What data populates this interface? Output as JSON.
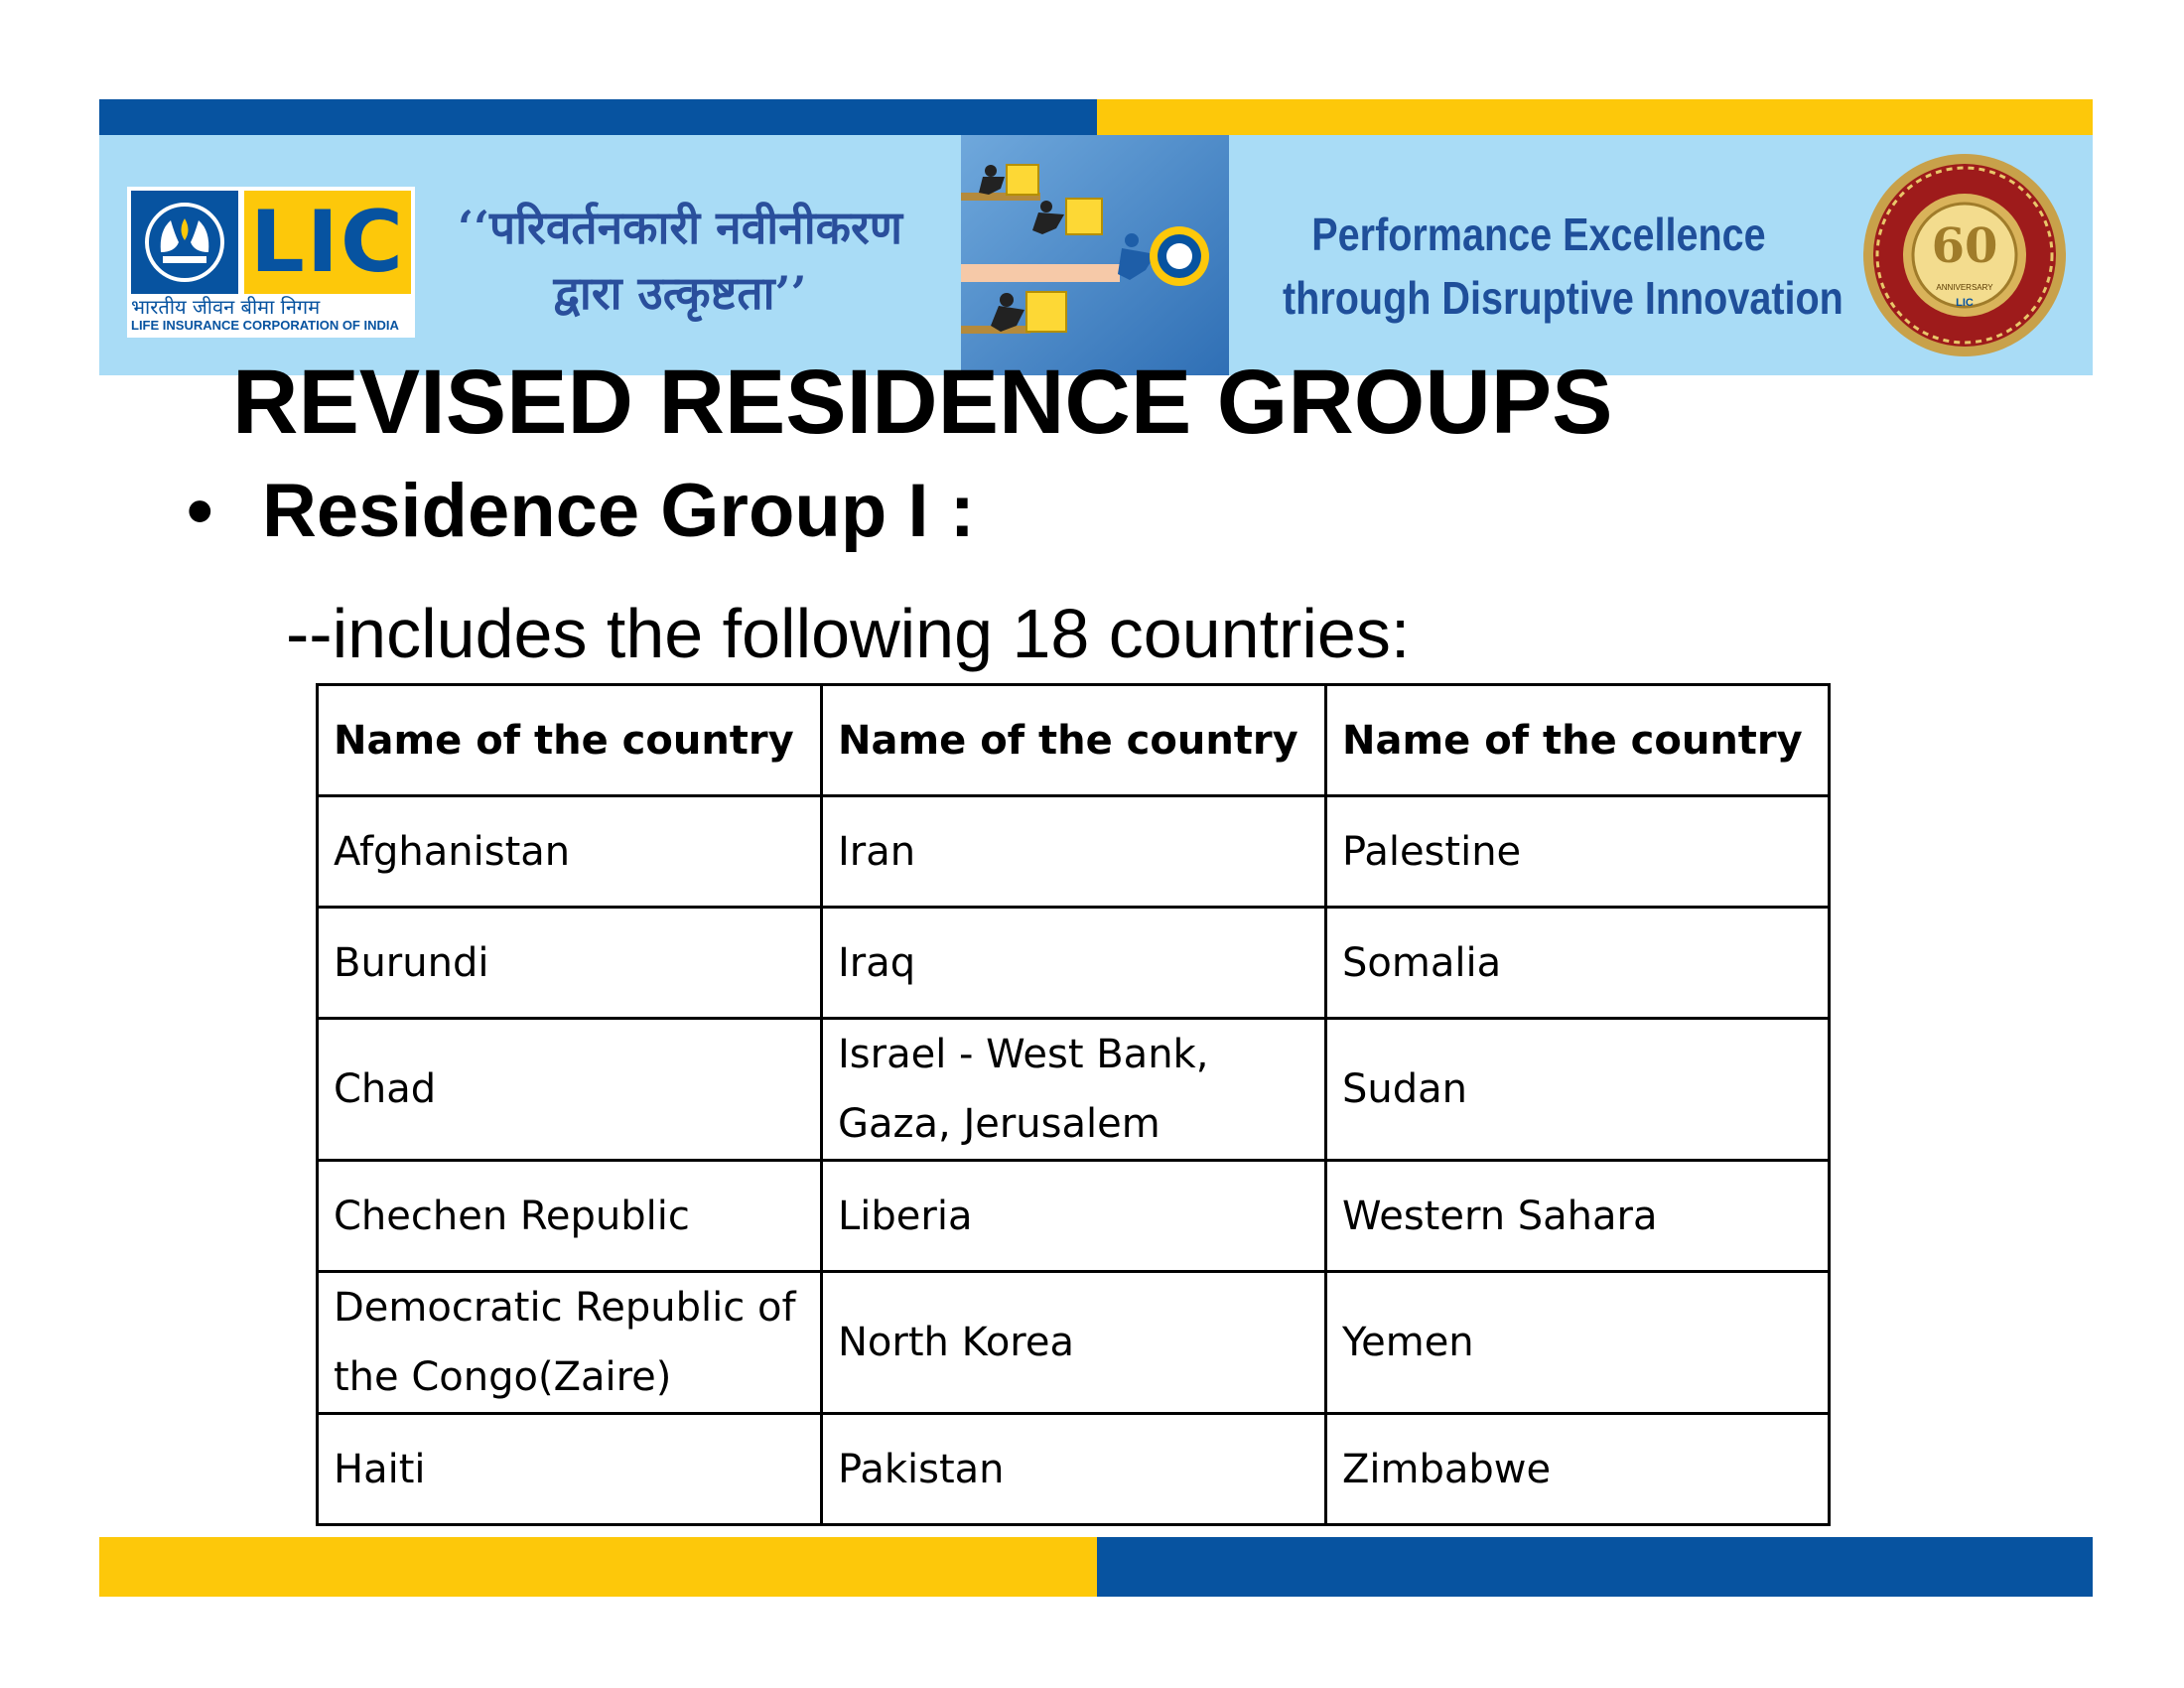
{
  "header": {
    "logo": {
      "word": "LIC",
      "hindi": "भारतीय जीवन बीमा निगम",
      "english": "LIFE INSURANCE CORPORATION OF INDIA"
    },
    "hindi_tagline": [
      "‘‘परिवर्तनकारी नवीनीकरण",
      "द्वारा उत्कृष्टता’’"
    ],
    "english_tagline": [
      "Performance Excellence",
      "through Disruptive Innovation"
    ],
    "seal": {
      "number": "60",
      "anniversary": "ANNIVERSARY",
      "brand": "LIC"
    }
  },
  "title": "REVISED RESIDENCE GROUPS",
  "bullet": {
    "dot": "•",
    "text": "Residence Group I :"
  },
  "subtitle": "--includes the following 18 countries:",
  "table": {
    "headers": [
      "Name of the country",
      "Name of the country",
      "Name of the country"
    ],
    "rows": [
      [
        "Afghanistan",
        "Iran",
        "Palestine"
      ],
      [
        "Burundi",
        "Iraq",
        "Somalia"
      ],
      [
        "Chad",
        "Israel - West Bank, Gaza, Jerusalem",
        "Sudan"
      ],
      [
        "Chechen Republic",
        "Liberia",
        "Western Sahara"
      ],
      [
        "Democratic  Republic of the Congo(Zaire)",
        "North Korea",
        "Yemen"
      ],
      [
        "Haiti",
        "Pakistan",
        "Zimbabwe"
      ]
    ]
  },
  "colors": {
    "blue": "#0753a0",
    "yellow": "#fdc80a",
    "light_blue": "#a9dcf6",
    "tagline_blue": "#1f4f9a"
  },
  "icons": [
    "lic-hands-icon",
    "pushing-boxes-illustration",
    "anniversary-seal-icon"
  ]
}
